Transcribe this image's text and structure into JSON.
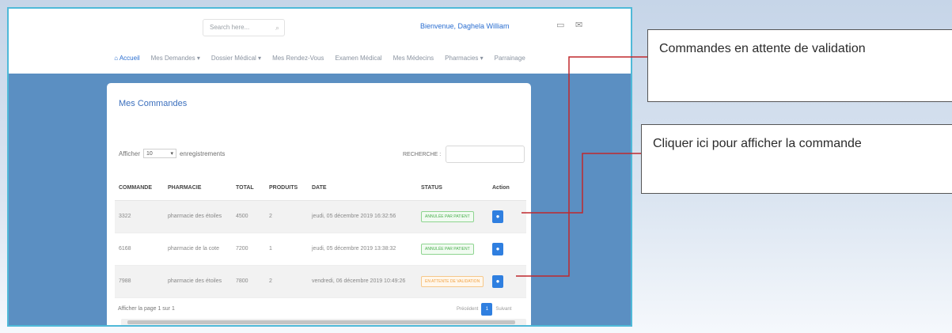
{
  "header": {
    "search_placeholder": "Search here...",
    "welcome": "Bienvenue, Daghela William",
    "icons": [
      "id-card-icon",
      "mail-icon"
    ]
  },
  "nav": {
    "items": [
      {
        "label": "Accueil",
        "active": true
      },
      {
        "label": "Mes Demandes ▾"
      },
      {
        "label": "Dossier Médical ▾"
      },
      {
        "label": "Mes Rendez-Vous"
      },
      {
        "label": "Examen Médical"
      },
      {
        "label": "Mes Médecins"
      },
      {
        "label": "Pharmacies ▾"
      },
      {
        "label": "Parrainage"
      }
    ]
  },
  "main": {
    "title": "Mes Commandes",
    "length_prefix": "Afficher",
    "length_value": "10",
    "length_suffix": "enregistrements",
    "search_label": "RECHERCHE :",
    "columns": [
      "COMMANDE",
      "PHARMACIE",
      "TOTAL",
      "PRODUITS",
      "DATE",
      "STATUS",
      "Action"
    ],
    "rows": [
      {
        "commande": "3322",
        "pharmacie": "pharmacie des étoiles",
        "total": "4500",
        "produits": "2",
        "date": "jeudi, 05 décembre 2019 16:32:56",
        "status": "ANNULÉE PAR PATIENT",
        "status_color": "green"
      },
      {
        "commande": "6168",
        "pharmacie": "pharmacie de la cote",
        "total": "7200",
        "produits": "1",
        "date": "jeudi, 05 décembre 2019 13:38:32",
        "status": "ANNULÉE PAR PATIENT",
        "status_color": "green"
      },
      {
        "commande": "7988",
        "pharmacie": "pharmacie des étoiles",
        "total": "7800",
        "produits": "2",
        "date": "vendredi, 06 décembre 2019 10:49:26",
        "status": "EN ATTENTE DE VALIDATION",
        "status_color": "orange"
      }
    ],
    "footer_info": "Afficher la page 1 sur 1",
    "pager": {
      "prev": "Précédent",
      "current": "1",
      "next": "Suivant"
    }
  },
  "callouts": {
    "pending": "Commandes en attente de validation",
    "view_order": "Cliquer ici pour afficher la commande"
  },
  "colors": {
    "accent": "#2f7fe0",
    "background": "#5b8fc2",
    "annotation_line": "#c0282d",
    "frame": "#4fb9d8"
  }
}
